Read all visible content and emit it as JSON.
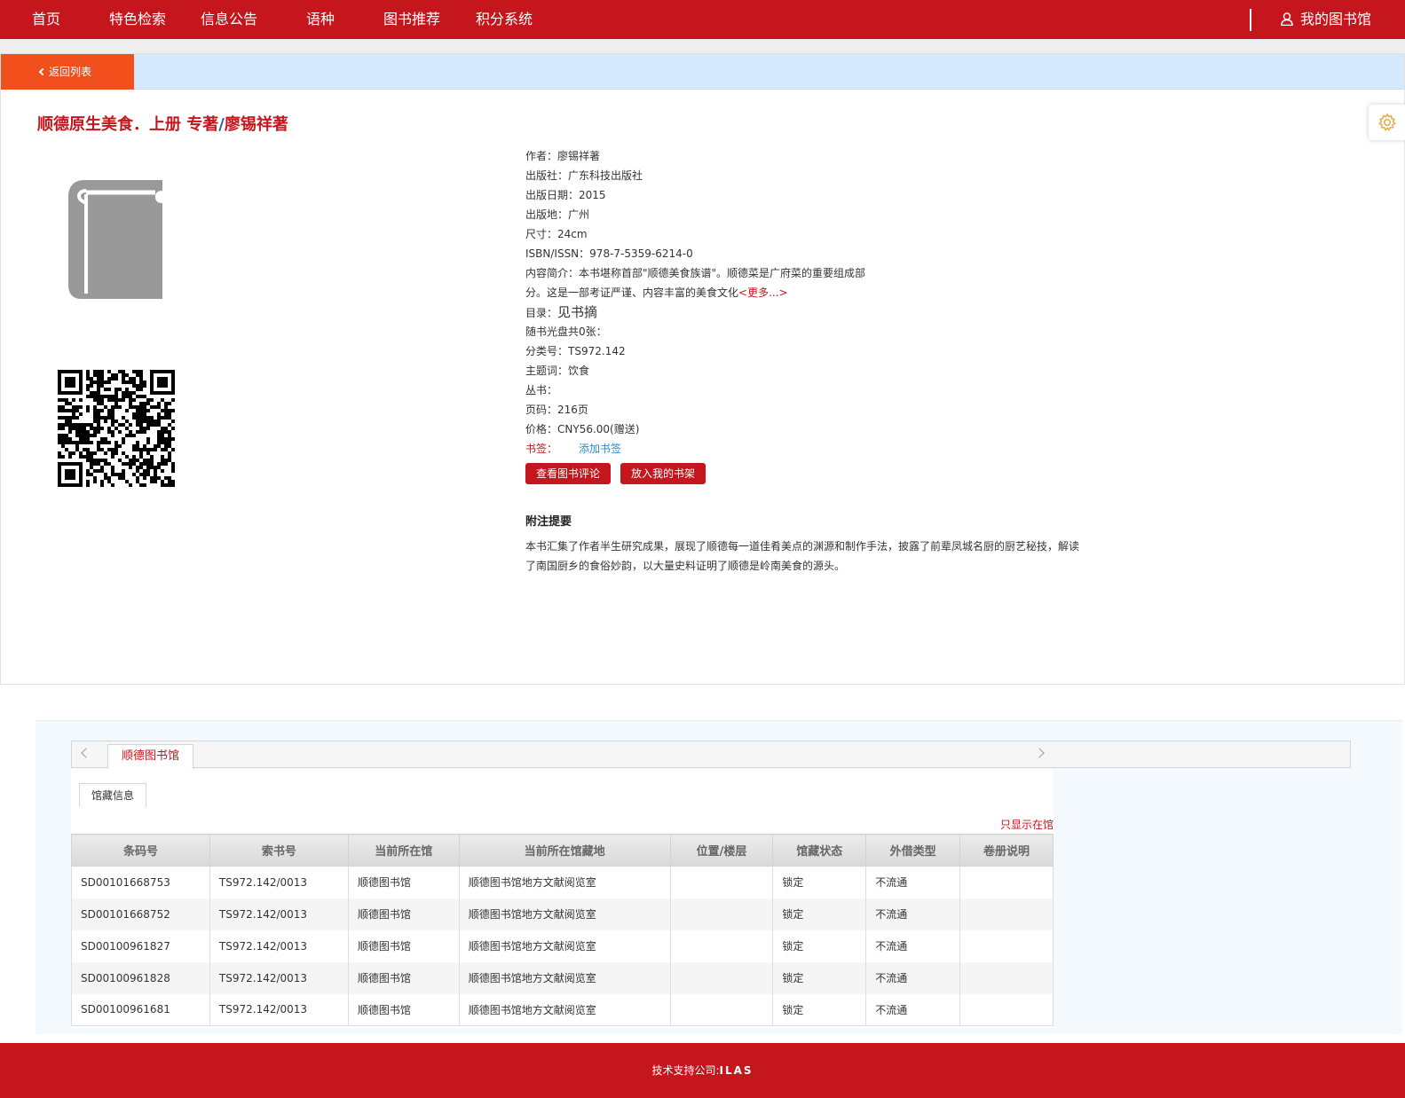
{
  "nav": {
    "items": [
      "首页",
      "特色检索",
      "信息公告",
      "语种",
      "图书推荐",
      "积分系统"
    ],
    "my_library": "我的图书馆"
  },
  "panel": {
    "back_label": "返回列表"
  },
  "book": {
    "title_main": "顺德原生美食．上册 专著",
    "title_slash": "/",
    "title_author": "廖锡祥著",
    "meta": {
      "author_label": "作者：",
      "author": "廖锡祥著",
      "publisher_label": "出版社：",
      "publisher": "广东科技出版社",
      "date_label": "出版日期：",
      "date": "2015",
      "place_label": "出版地：",
      "place": "广州",
      "size_label": "尺寸：",
      "size": "24cm",
      "isbn_label": "ISBN/ISSN：",
      "isbn": "978-7-5359-6214-0",
      "summary_label": "内容简介：",
      "summary_line1": "本书堪称首部\"顺德美食族谱\"。顺德菜是广府菜的重要组成部",
      "summary_line2": "分。这是一部考证严谨、内容丰富的美食文化",
      "more": "<更多...>",
      "toc_label": "目录：",
      "toc": "见书摘",
      "disc": "随书光盘共0张：",
      "class_label": "分类号：",
      "class_no": "TS972.142",
      "subject_label": "主题词：",
      "subject": "饮食",
      "series_label": "丛书：",
      "series": "",
      "pages_label": "页码：",
      "pages": "216页",
      "price_label": "价格：",
      "price": "CNY56.00(赠送)",
      "bookmark_label": "书签：",
      "add_bookmark": "添加书签"
    },
    "btn_reviews": "查看图书评论",
    "btn_shelf": "放入我的书架",
    "notes_title": "附注提要",
    "notes_text": "本书汇集了作者半生研究成果，展现了顺德每一道佳肴美点的渊源和制作手法，披露了前辈凤城名厨的厨艺秘技，解读了南国厨乡的食俗妙韵，以大量史料证明了顺德是岭南美食的源头。"
  },
  "holdings": {
    "library_tab": "顺德图书馆",
    "subtab": "馆藏信息",
    "only_show": "只显示在馆",
    "columns": [
      "条码号",
      "索书号",
      "当前所在馆",
      "当前所在馆藏地",
      "位置/楼层",
      "馆藏状态",
      "外借类型",
      "卷册说明"
    ],
    "rows": [
      [
        "SD00101668753",
        "TS972.142/0013",
        "顺德图书馆",
        "顺德图书馆地方文献阅览室",
        "",
        "锁定",
        "不流通",
        ""
      ],
      [
        "SD00101668752",
        "TS972.142/0013",
        "顺德图书馆",
        "顺德图书馆地方文献阅览室",
        "",
        "锁定",
        "不流通",
        ""
      ],
      [
        "SD00100961827",
        "TS972.142/0013",
        "顺德图书馆",
        "顺德图书馆地方文献阅览室",
        "",
        "锁定",
        "不流通",
        ""
      ],
      [
        "SD00100961828",
        "TS972.142/0013",
        "顺德图书馆",
        "顺德图书馆地方文献阅览室",
        "",
        "锁定",
        "不流通",
        ""
      ],
      [
        "SD00100961681",
        "TS972.142/0013",
        "顺德图书馆",
        "顺德图书馆地方文献阅览室",
        "",
        "锁定",
        "不流通",
        ""
      ]
    ]
  },
  "footer": {
    "label": "技术支持公司:",
    "company": "ILAS"
  }
}
